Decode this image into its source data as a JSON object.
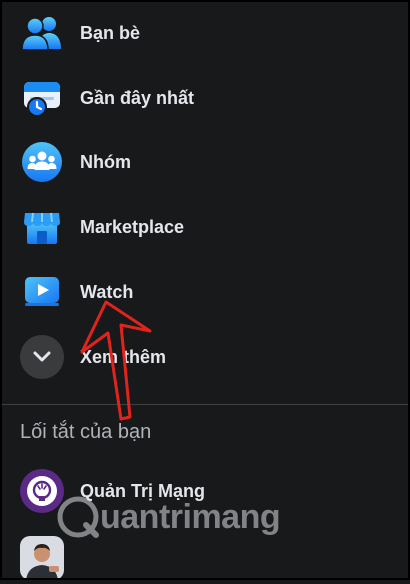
{
  "menu": {
    "items": [
      {
        "label": "Bạn bè",
        "icon": "friends-icon"
      },
      {
        "label": "Gần đây nhất",
        "icon": "recent-feed-icon"
      },
      {
        "label": "Nhóm",
        "icon": "groups-icon"
      },
      {
        "label": "Marketplace",
        "icon": "marketplace-icon"
      },
      {
        "label": "Watch",
        "icon": "watch-icon"
      },
      {
        "label": "Xem thêm",
        "icon": "chevron-down-icon"
      }
    ]
  },
  "shortcuts": {
    "title": "Lối tắt của bạn",
    "items": [
      {
        "label": "Quản Trị Mạng",
        "icon": "lightbulb-icon"
      },
      {
        "label": "",
        "icon": "avatar"
      }
    ]
  },
  "watermark": {
    "text": "uantrimang"
  },
  "colors": {
    "accent": "#1b74e4",
    "annotation_arrow": "#e0241b",
    "background": "#18191a"
  }
}
